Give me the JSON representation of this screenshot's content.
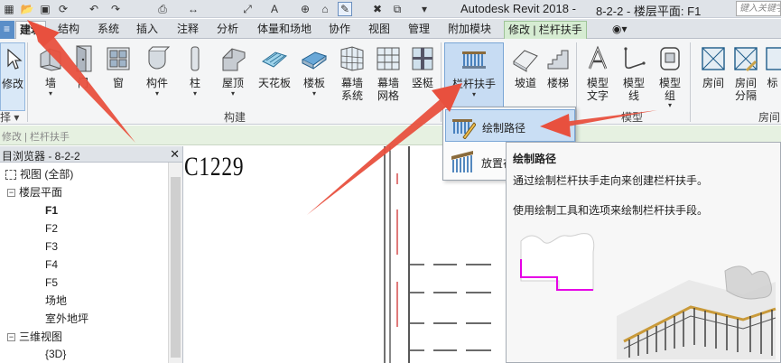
{
  "title_bar": {
    "app_title": "Autodesk Revit 2018 -",
    "doc_title": "8-2-2 - 楼层平面: F1",
    "search_placeholder": "键入关键字"
  },
  "tabs": [
    {
      "label": "建筑"
    },
    {
      "label": "结构"
    },
    {
      "label": "系统"
    },
    {
      "label": "插入"
    },
    {
      "label": "注释"
    },
    {
      "label": "分析"
    },
    {
      "label": "体量和场地"
    },
    {
      "label": "协作"
    },
    {
      "label": "视图"
    },
    {
      "label": "管理"
    },
    {
      "label": "附加模块"
    },
    {
      "label": "修改 | 栏杆扶手"
    }
  ],
  "ribbon": {
    "modify_label": "修改",
    "select_label": "择",
    "buttons": [
      {
        "label": "墙"
      },
      {
        "label": "门"
      },
      {
        "label": "窗"
      },
      {
        "label": "构件"
      },
      {
        "label": "柱"
      },
      {
        "label": "屋顶"
      },
      {
        "label": "天花板"
      },
      {
        "label": "楼板"
      },
      {
        "label": "幕墙\n系统"
      },
      {
        "label": "幕墙\n网格"
      },
      {
        "label": "竖梃"
      },
      {
        "label": "栏杆扶手"
      },
      {
        "label": "坡道"
      },
      {
        "label": "楼梯"
      },
      {
        "label": "模型\n文字"
      },
      {
        "label": "模型\n线"
      },
      {
        "label": "模型\n组"
      },
      {
        "label": "房间"
      },
      {
        "label": "房间\n分隔"
      },
      {
        "label": "标"
      }
    ],
    "panel_build": "构建",
    "panel_model": "模型",
    "panel_room": "房间"
  },
  "options_bar": {
    "text": "修改 | 栏杆扶手"
  },
  "project_browser": {
    "title": "目浏览器 - 8-2-2",
    "views_root": "视图 (全部)",
    "floor_plans": "楼层平面",
    "floors": [
      "F1",
      "F2",
      "F3",
      "F4",
      "F5",
      "场地",
      "室外地坪"
    ],
    "three_d": "三维视图",
    "three_d_item": "{3D}"
  },
  "canvas": {
    "label": "C1229"
  },
  "dropdown": {
    "items": [
      {
        "label": "绘制路径"
      },
      {
        "label": "放置在"
      }
    ]
  },
  "tooltip": {
    "title": "绘制路径",
    "desc1": "通过绘制栏杆扶手走向来创建栏杆扶手。",
    "desc2": "使用绘制工具和选项来绘制栏杆扶手段。"
  },
  "colors": {
    "arrow": "#e8503e",
    "sketch_path": "#e600e6",
    "accent_blue": "#2b6cb0"
  }
}
